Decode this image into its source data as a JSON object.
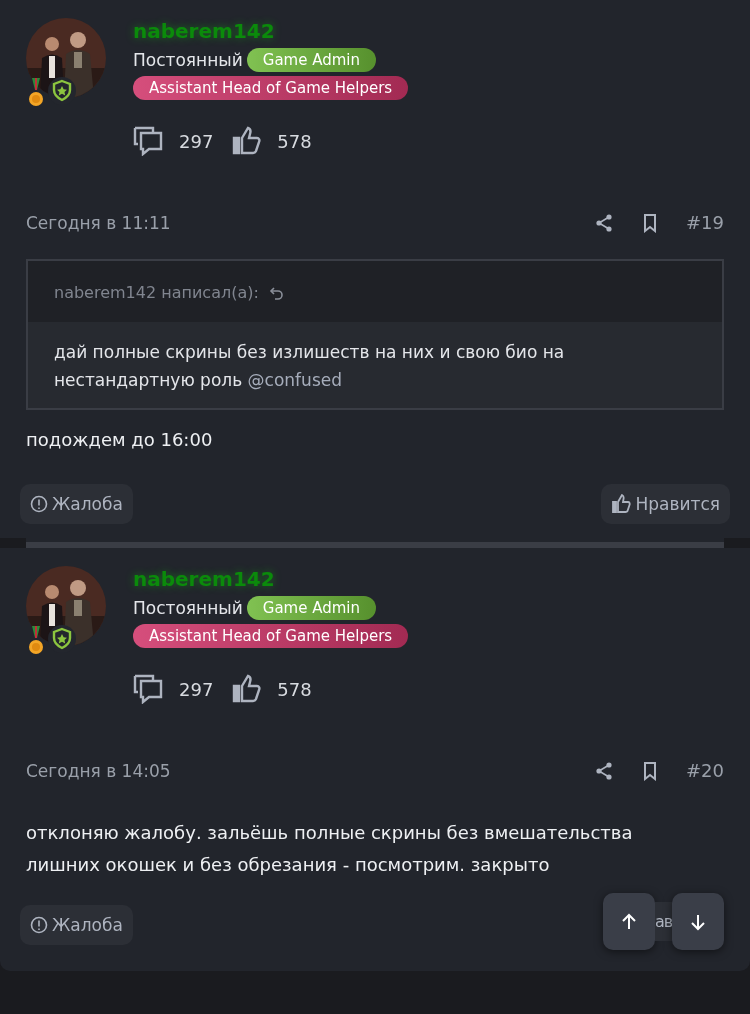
{
  "posts": [
    {
      "author": "naberem142",
      "rank": "Постоянный",
      "badges": [
        {
          "label": "Game Admin",
          "color": "#6fb93a"
        },
        {
          "label": "Assistant Head of Game Helpers",
          "color": "#d0366a"
        }
      ],
      "messages": "297",
      "likes": "578",
      "time": "Сегодня в 11:11",
      "number": "#19",
      "quote": {
        "header": "naberem142 написал(а):",
        "text": "дай полные скрины без излишеств на них и свою био на нестандартную роль",
        "mention": "@confused"
      },
      "body": "подождем до 16:00",
      "report": "Жалоба",
      "like": "Нравится",
      "like_covered": false
    },
    {
      "author": "naberem142",
      "rank": "Постоянный",
      "badges": [
        {
          "label": "Game Admin",
          "color": "#6fb93a"
        },
        {
          "label": "Assistant Head of Game Helpers",
          "color": "#d0366a"
        }
      ],
      "messages": "297",
      "likes": "578",
      "time": "Сегодня в 14:05",
      "number": "#20",
      "body": "отклоняю жалобу. зальёшь полные скрины без вмешательства лишних окошек и без обрезания - посмотрим. закрыто",
      "report": "Жалоба",
      "like": "ав",
      "like_covered": true
    }
  ],
  "scroll_buttons": [
    {
      "kind": "up"
    },
    {
      "kind": "down"
    }
  ]
}
